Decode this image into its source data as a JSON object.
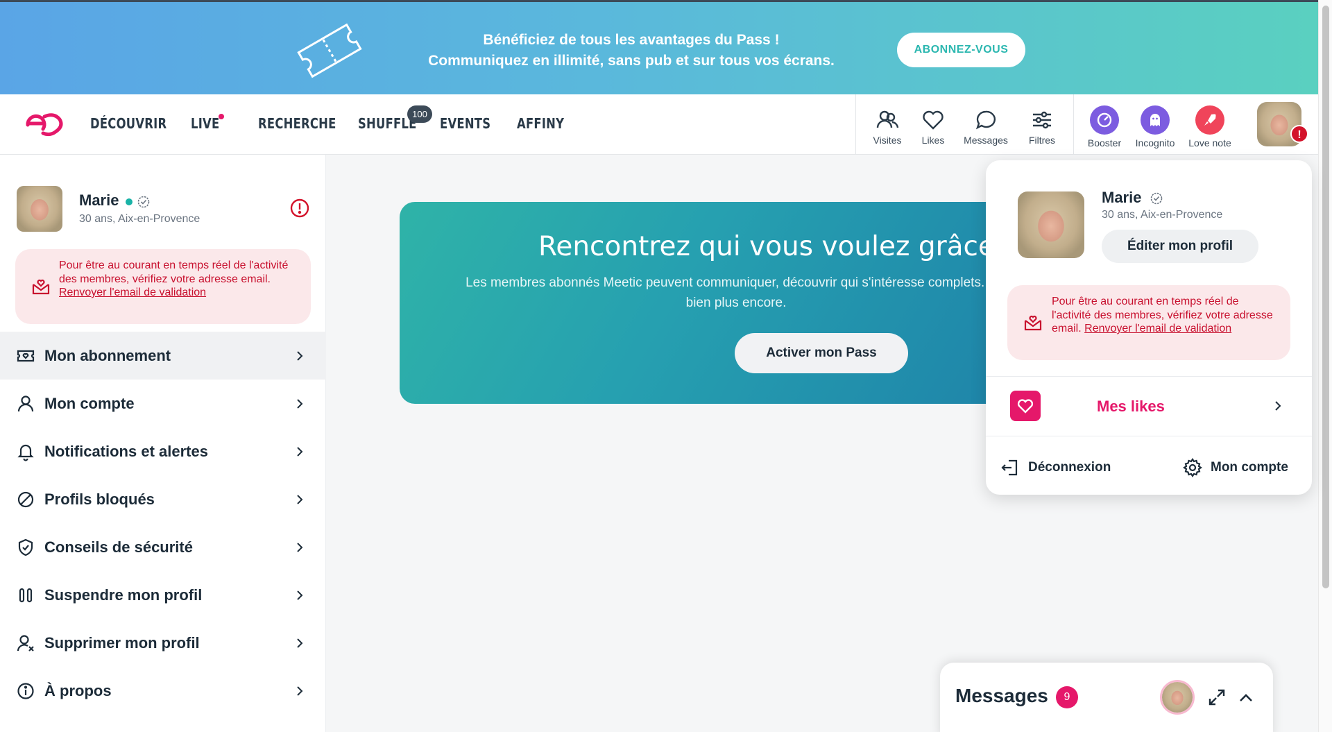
{
  "promo": {
    "line1": "Bénéficiez de tous les avantages du Pass !",
    "line2": "Communiquez en illimité, sans pub et sur tous vos écrans.",
    "cta": "ABONNEZ-VOUS"
  },
  "nav": {
    "links": [
      "DÉCOUVRIR",
      "LIVE",
      "RECHERCHE",
      "SHUFFLE",
      "EVENTS",
      "AFFINY"
    ],
    "shuffle_badge": "100",
    "tools": [
      "Visites",
      "Likes",
      "Messages",
      "Filtres"
    ],
    "messages_badge": "9",
    "premium": [
      "Booster",
      "Incognito",
      "Love note"
    ],
    "avatar_alert": "!"
  },
  "colors": {
    "accent": "#e5186a",
    "teal": "#19b3a7",
    "error": "#c8102e"
  },
  "sidebar": {
    "name": "Marie",
    "subtitle": "30 ans, Aix-en-Provence",
    "warning_text": "Pour être au courant en temps réel de l'activité des membres, vérifiez votre adresse email.",
    "warning_link": "Renvoyer l'email de validation",
    "items": [
      {
        "label": "Mon abonnement",
        "icon": "ticket-icon"
      },
      {
        "label": "Mon compte",
        "icon": "user-icon"
      },
      {
        "label": "Notifications et alertes",
        "icon": "bell-icon"
      },
      {
        "label": "Profils bloqués",
        "icon": "blocked-icon"
      },
      {
        "label": "Conseils de sécurité",
        "icon": "shield-icon"
      },
      {
        "label": "Suspendre mon profil",
        "icon": "pause-icon"
      },
      {
        "label": "Supprimer mon profil",
        "icon": "user-remove-icon"
      },
      {
        "label": "À propos",
        "icon": "info-icon"
      }
    ]
  },
  "hero": {
    "title": "Rencontrez qui vous voulez grâce",
    "subtitle": "Les membres abonnés Meetic peuvent communiquer, découvrir qui s'intéresse complets... et bien plus encore.",
    "cta": "Activer mon Pass"
  },
  "dropdown": {
    "name": "Marie",
    "subtitle": "30 ans, Aix-en-Provence",
    "edit": "Éditer mon profil",
    "warning_text": "Pour être au courant en temps réel de l'activité des membres, vérifiez votre adresse email.",
    "warning_link": "Renvoyer l'email de validation",
    "likes": "Mes likes",
    "logout": "Déconnexion",
    "account": "Mon compte"
  },
  "messages_dock": {
    "title": "Messages",
    "badge": "9"
  }
}
